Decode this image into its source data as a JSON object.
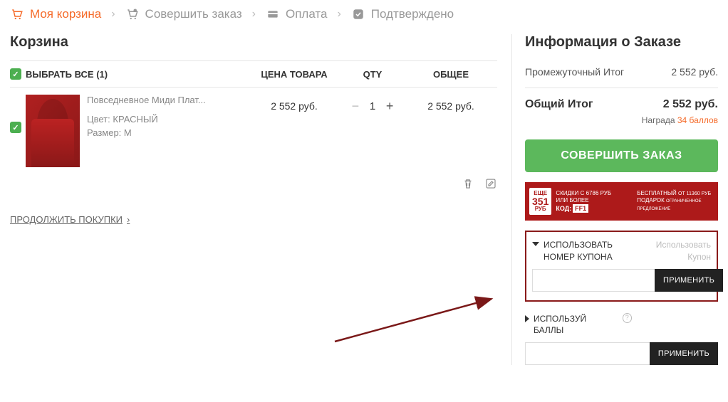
{
  "breadcrumb": {
    "cart": "Моя корзина",
    "checkout": "Совершить заказ",
    "payment": "Оплата",
    "confirmed": "Подтверждено"
  },
  "cart": {
    "title": "Корзина",
    "select_all": "ВЫБРАТЬ ВСЕ (1)",
    "col_price": "ЦЕНА ТОВАРА",
    "col_qty": "QTY",
    "col_total": "ОБЩЕЕ",
    "items": [
      {
        "name": "Повседневное Миди Плат...",
        "color_label": "Цвет:",
        "color_value": "КРАСНЫЙ",
        "size_label": "Размер:",
        "size_value": "M",
        "price": "2 552 руб.",
        "qty": "1",
        "total": "2 552 руб."
      }
    ],
    "continue": "ПРОДОЛЖИТЬ ПОКУПКИ"
  },
  "order": {
    "title": "Информация о Заказе",
    "subtotal_label": "Промежуточный Итог",
    "subtotal_value": "2 552 руб.",
    "total_label": "Общий Итог",
    "total_value": "2 552 руб.",
    "reward_label": "Награда",
    "reward_value": "34 баллов",
    "checkout": "СОВЕРШИТЬ ЗАКАЗ",
    "promo": {
      "badge_top": "ЕЩЕ",
      "badge_big": "351",
      "badge_bot": "РУБ",
      "line1": "СКИДКИ С 6786 РУБ",
      "line2": "ИЛИ БОЛЕЕ",
      "code_label": "КОД:",
      "code": "FF1",
      "right1": "БЕСПЛАТНЫЙ",
      "right1b": "ОТ 11360 РУБ",
      "right2": "ПОДАРОК",
      "right2b": "ОГРАНИЧЕННОЕ ПРЕДЛОЖЕНИЕ"
    },
    "coupon": {
      "title": "ИСПОЛЬЗОВАТЬ НОМЕР КУПОНА",
      "hint": "Использовать Купон",
      "apply": "ПРИМЕНИТЬ"
    },
    "points": {
      "title": "ИСПОЛЬЗУЙ БАЛЛЫ",
      "apply": "ПРИМЕНИТЬ"
    }
  }
}
